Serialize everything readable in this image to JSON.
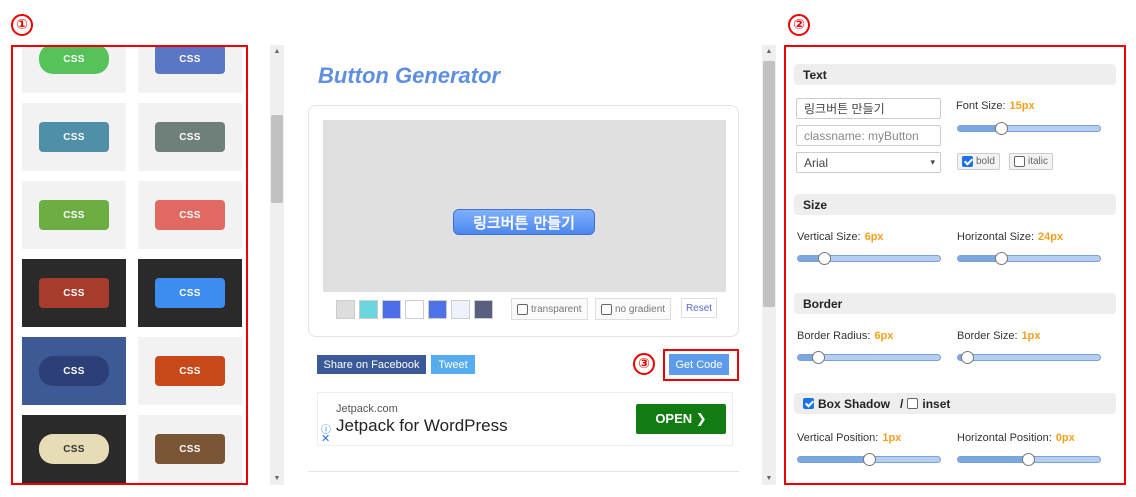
{
  "annotations": {
    "one": "①",
    "two": "②",
    "three": "③"
  },
  "templates": [
    {
      "label": "CSS",
      "fg": "#ffffff",
      "bg": "#56c25a",
      "tile": "light"
    },
    {
      "label": "CSS",
      "fg": "#ffffff",
      "bg": "#5a76c4",
      "tile": "light"
    },
    {
      "label": "CSS",
      "fg": "#ffffff",
      "bg": "#4f8fa8",
      "tile": "light"
    },
    {
      "label": "CSS",
      "fg": "#ffffff",
      "bg": "#6f807a",
      "tile": "light"
    },
    {
      "label": "CSS",
      "fg": "#ffffff",
      "bg": "#6cae44",
      "tile": "light"
    },
    {
      "label": "CSS",
      "fg": "#ffffff",
      "bg": "#e06a62",
      "tile": "light"
    },
    {
      "label": "CSS",
      "fg": "#ffffff",
      "bg": "#a83c2c",
      "tile": "dark"
    },
    {
      "label": "CSS",
      "fg": "#ffffff",
      "bg": "#3d8cf0",
      "tile": "dark"
    },
    {
      "label": "CSS",
      "fg": "#ffffff",
      "bg": "#2c3f77",
      "tile": "blue"
    },
    {
      "label": "CSS",
      "fg": "#ffffff",
      "bg": "#c8481a",
      "tile": "light"
    },
    {
      "label": "CSS",
      "fg": "#333333",
      "bg": "#e6dcb6",
      "tile": "dark"
    },
    {
      "label": "CSS",
      "fg": "#ffffff",
      "bg": "#7a5536",
      "tile": "light"
    }
  ],
  "generator": {
    "title": "Button Generator",
    "preview_label": "링크버튼 만들기",
    "swatches": [
      "#dddddd",
      "#6cd6df",
      "#4d6ee8",
      "#ffffff",
      "#4f72e6",
      "#eef2fb",
      "#5a5f80"
    ],
    "transparent_label": "transparent",
    "no_gradient_label": "no gradient",
    "reset_label": "Reset",
    "share_facebook": "Share on Facebook",
    "tweet": "Tweet",
    "get_code": "Get Code"
  },
  "ad": {
    "domain": "Jetpack.com",
    "title": "Jetpack for WordPress",
    "cta": "OPEN ❯"
  },
  "text_section": {
    "title": "Text",
    "text_value": "링크버튼 만들기",
    "classname_placeholder": "classname: myButton",
    "font_value": "Arial",
    "font_size_label": "Font Size:",
    "font_size_value": "15px",
    "font_size_level": 0.3,
    "bold_label": "bold",
    "bold_checked": true,
    "italic_label": "italic",
    "italic_checked": false
  },
  "size_section": {
    "title": "Size",
    "vertical_label": "Vertical Size:",
    "vertical_value": "6px",
    "vertical_level": 0.18,
    "horizontal_label": "Horizontal Size:",
    "horizontal_value": "24px",
    "horizontal_level": 0.3
  },
  "border_section": {
    "title": "Border",
    "radius_label": "Border Radius:",
    "radius_value": "6px",
    "radius_level": 0.14,
    "size_label": "Border Size:",
    "size_value": "1px",
    "size_level": 0.06
  },
  "shadow_section": {
    "title": "Box Shadow",
    "separator": "/",
    "inset_label": "inset",
    "shadow_checked": true,
    "inset_checked": false,
    "vpos_label": "Vertical Position:",
    "vpos_value": "1px",
    "vpos_level": 0.5,
    "hpos_label": "Horizontal Position:",
    "hpos_value": "0px",
    "hpos_level": 0.49
  }
}
